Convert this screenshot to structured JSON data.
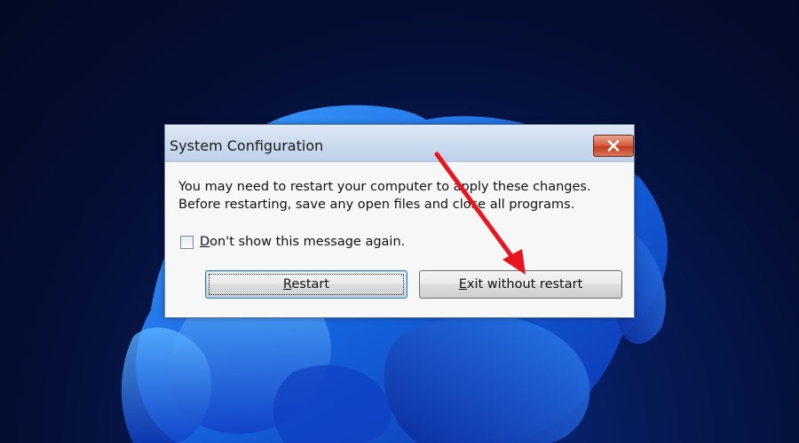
{
  "dialog": {
    "title": "System Configuration",
    "close_icon": "close-icon",
    "message_line1": "You may need to restart your computer to apply these changes.",
    "message_line2": "Before restarting, save any open files and close all programs.",
    "checkbox": {
      "label_prefix": "D",
      "label_rest": "on't show this message again.",
      "checked": false
    },
    "buttons": {
      "restart_prefix": "R",
      "restart_rest": "estart",
      "exit_prefix": "E",
      "exit_rest": "xit without restart"
    }
  },
  "annotation": {
    "type": "arrow",
    "color": "#e8141e"
  },
  "colors": {
    "accent": "#3c7fb1",
    "close": "#c23b1d"
  }
}
